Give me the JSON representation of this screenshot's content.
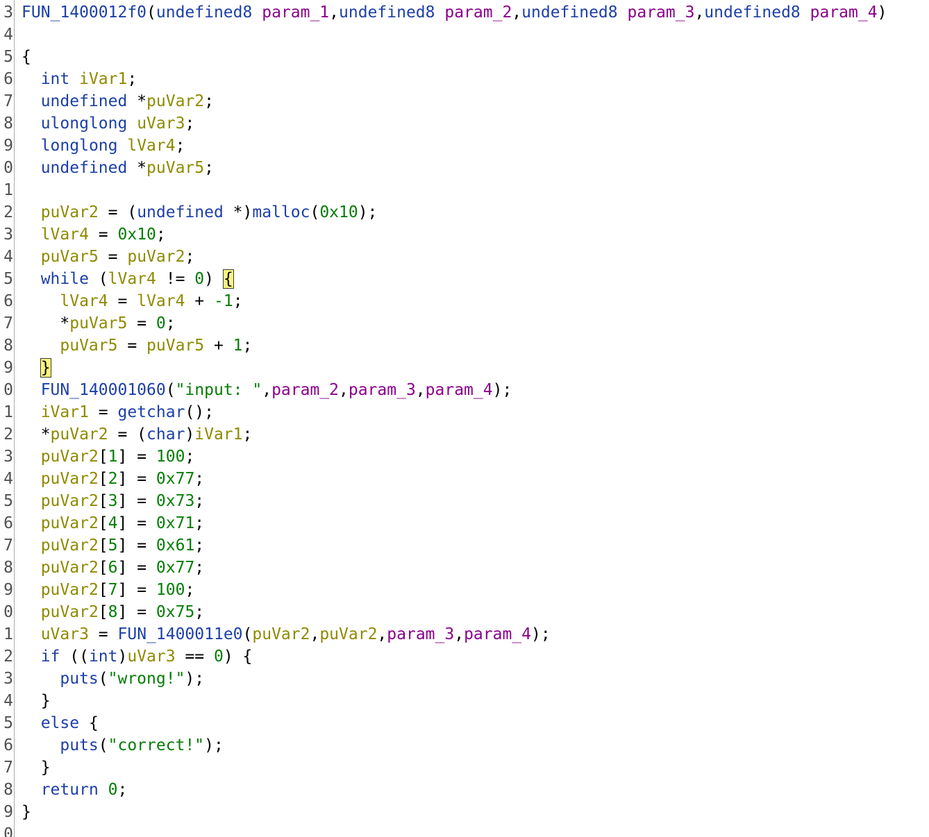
{
  "decompiler": {
    "colors": {
      "type": "#1d3fa8",
      "param": "#8b008b",
      "variable": "#8e8a00",
      "number": "#047d04",
      "string": "#047d04",
      "highlight": "#fbf77d"
    },
    "lines": [
      {
        "n": "3",
        "tokens": [
          {
            "t": "FUN_1400012f0",
            "c": "fn"
          },
          {
            "t": "(",
            "c": "punc"
          },
          {
            "t": "undefined8",
            "c": "type"
          },
          {
            "t": " ",
            "c": "punc"
          },
          {
            "t": "param_1",
            "c": "param"
          },
          {
            "t": ",",
            "c": "punc"
          },
          {
            "t": "undefined8",
            "c": "type"
          },
          {
            "t": " ",
            "c": "punc"
          },
          {
            "t": "param_2",
            "c": "param"
          },
          {
            "t": ",",
            "c": "punc"
          },
          {
            "t": "undefined8",
            "c": "type"
          },
          {
            "t": " ",
            "c": "punc"
          },
          {
            "t": "param_3",
            "c": "param"
          },
          {
            "t": ",",
            "c": "punc"
          },
          {
            "t": "undefined8",
            "c": "type"
          },
          {
            "t": " ",
            "c": "punc"
          },
          {
            "t": "param_4",
            "c": "param"
          },
          {
            "t": ")",
            "c": "punc"
          }
        ]
      },
      {
        "n": "4",
        "tokens": []
      },
      {
        "n": "5",
        "tokens": [
          {
            "t": "{",
            "c": "punc"
          }
        ]
      },
      {
        "n": "6",
        "tokens": [
          {
            "t": "  ",
            "c": "punc"
          },
          {
            "t": "int",
            "c": "type"
          },
          {
            "t": " ",
            "c": "punc"
          },
          {
            "t": "iVar1",
            "c": "var"
          },
          {
            "t": ";",
            "c": "punc"
          }
        ]
      },
      {
        "n": "7",
        "tokens": [
          {
            "t": "  ",
            "c": "punc"
          },
          {
            "t": "undefined",
            "c": "type"
          },
          {
            "t": " *",
            "c": "punc"
          },
          {
            "t": "puVar2",
            "c": "var"
          },
          {
            "t": ";",
            "c": "punc"
          }
        ]
      },
      {
        "n": "8",
        "tokens": [
          {
            "t": "  ",
            "c": "punc"
          },
          {
            "t": "ulonglong",
            "c": "type"
          },
          {
            "t": " ",
            "c": "punc"
          },
          {
            "t": "uVar3",
            "c": "var"
          },
          {
            "t": ";",
            "c": "punc"
          }
        ]
      },
      {
        "n": "9",
        "tokens": [
          {
            "t": "  ",
            "c": "punc"
          },
          {
            "t": "longlong",
            "c": "type"
          },
          {
            "t": " ",
            "c": "punc"
          },
          {
            "t": "lVar4",
            "c": "var"
          },
          {
            "t": ";",
            "c": "punc"
          }
        ]
      },
      {
        "n": "0",
        "tokens": [
          {
            "t": "  ",
            "c": "punc"
          },
          {
            "t": "undefined",
            "c": "type"
          },
          {
            "t": " *",
            "c": "punc"
          },
          {
            "t": "puVar5",
            "c": "var"
          },
          {
            "t": ";",
            "c": "punc"
          }
        ]
      },
      {
        "n": "1",
        "tokens": []
      },
      {
        "n": "2",
        "tokens": [
          {
            "t": "  ",
            "c": "punc"
          },
          {
            "t": "puVar2",
            "c": "var"
          },
          {
            "t": " = (",
            "c": "punc"
          },
          {
            "t": "undefined",
            "c": "type"
          },
          {
            "t": " *)",
            "c": "punc"
          },
          {
            "t": "malloc",
            "c": "fn"
          },
          {
            "t": "(",
            "c": "punc"
          },
          {
            "t": "0x10",
            "c": "num"
          },
          {
            "t": ");",
            "c": "punc"
          }
        ]
      },
      {
        "n": "3",
        "tokens": [
          {
            "t": "  ",
            "c": "punc"
          },
          {
            "t": "lVar4",
            "c": "var"
          },
          {
            "t": " = ",
            "c": "punc"
          },
          {
            "t": "0x10",
            "c": "num"
          },
          {
            "t": ";",
            "c": "punc"
          }
        ]
      },
      {
        "n": "4",
        "tokens": [
          {
            "t": "  ",
            "c": "punc"
          },
          {
            "t": "puVar5",
            "c": "var"
          },
          {
            "t": " = ",
            "c": "punc"
          },
          {
            "t": "puVar2",
            "c": "var"
          },
          {
            "t": ";",
            "c": "punc"
          }
        ]
      },
      {
        "n": "5",
        "tokens": [
          {
            "t": "  ",
            "c": "punc"
          },
          {
            "t": "while",
            "c": "kw"
          },
          {
            "t": " (",
            "c": "punc"
          },
          {
            "t": "lVar4",
            "c": "var"
          },
          {
            "t": " != ",
            "c": "punc"
          },
          {
            "t": "0",
            "c": "num"
          },
          {
            "t": ") ",
            "c": "punc"
          },
          {
            "t": "{",
            "c": "hl"
          }
        ]
      },
      {
        "n": "6",
        "tokens": [
          {
            "t": "    ",
            "c": "punc"
          },
          {
            "t": "lVar4",
            "c": "var"
          },
          {
            "t": " = ",
            "c": "punc"
          },
          {
            "t": "lVar4",
            "c": "var"
          },
          {
            "t": " + ",
            "c": "punc"
          },
          {
            "t": "-1",
            "c": "num"
          },
          {
            "t": ";",
            "c": "punc"
          }
        ]
      },
      {
        "n": "7",
        "tokens": [
          {
            "t": "    *",
            "c": "punc"
          },
          {
            "t": "puVar5",
            "c": "var"
          },
          {
            "t": " = ",
            "c": "punc"
          },
          {
            "t": "0",
            "c": "num"
          },
          {
            "t": ";",
            "c": "punc"
          }
        ]
      },
      {
        "n": "8",
        "tokens": [
          {
            "t": "    ",
            "c": "punc"
          },
          {
            "t": "puVar5",
            "c": "var"
          },
          {
            "t": " = ",
            "c": "punc"
          },
          {
            "t": "puVar5",
            "c": "var"
          },
          {
            "t": " + ",
            "c": "punc"
          },
          {
            "t": "1",
            "c": "num"
          },
          {
            "t": ";",
            "c": "punc"
          }
        ]
      },
      {
        "n": "9",
        "tokens": [
          {
            "t": "  ",
            "c": "punc"
          },
          {
            "t": "}",
            "c": "hl"
          }
        ]
      },
      {
        "n": "0",
        "tokens": [
          {
            "t": "  ",
            "c": "punc"
          },
          {
            "t": "FUN_140001060",
            "c": "fn"
          },
          {
            "t": "(",
            "c": "punc"
          },
          {
            "t": "\"input: \"",
            "c": "str"
          },
          {
            "t": ",",
            "c": "punc"
          },
          {
            "t": "param_2",
            "c": "param"
          },
          {
            "t": ",",
            "c": "punc"
          },
          {
            "t": "param_3",
            "c": "param"
          },
          {
            "t": ",",
            "c": "punc"
          },
          {
            "t": "param_4",
            "c": "param"
          },
          {
            "t": ");",
            "c": "punc"
          }
        ]
      },
      {
        "n": "1",
        "tokens": [
          {
            "t": "  ",
            "c": "punc"
          },
          {
            "t": "iVar1",
            "c": "var"
          },
          {
            "t": " = ",
            "c": "punc"
          },
          {
            "t": "getchar",
            "c": "fn"
          },
          {
            "t": "();",
            "c": "punc"
          }
        ]
      },
      {
        "n": "2",
        "tokens": [
          {
            "t": "  *",
            "c": "punc"
          },
          {
            "t": "puVar2",
            "c": "var"
          },
          {
            "t": " = (",
            "c": "punc"
          },
          {
            "t": "char",
            "c": "type"
          },
          {
            "t": ")",
            "c": "punc"
          },
          {
            "t": "iVar1",
            "c": "var"
          },
          {
            "t": ";",
            "c": "punc"
          }
        ]
      },
      {
        "n": "3",
        "tokens": [
          {
            "t": "  ",
            "c": "punc"
          },
          {
            "t": "puVar2",
            "c": "var"
          },
          {
            "t": "[",
            "c": "punc"
          },
          {
            "t": "1",
            "c": "num"
          },
          {
            "t": "] = ",
            "c": "punc"
          },
          {
            "t": "100",
            "c": "num"
          },
          {
            "t": ";",
            "c": "punc"
          }
        ]
      },
      {
        "n": "4",
        "tokens": [
          {
            "t": "  ",
            "c": "punc"
          },
          {
            "t": "puVar2",
            "c": "var"
          },
          {
            "t": "[",
            "c": "punc"
          },
          {
            "t": "2",
            "c": "num"
          },
          {
            "t": "] = ",
            "c": "punc"
          },
          {
            "t": "0x77",
            "c": "num"
          },
          {
            "t": ";",
            "c": "punc"
          }
        ]
      },
      {
        "n": "5",
        "tokens": [
          {
            "t": "  ",
            "c": "punc"
          },
          {
            "t": "puVar2",
            "c": "var"
          },
          {
            "t": "[",
            "c": "punc"
          },
          {
            "t": "3",
            "c": "num"
          },
          {
            "t": "] = ",
            "c": "punc"
          },
          {
            "t": "0x73",
            "c": "num"
          },
          {
            "t": ";",
            "c": "punc"
          }
        ]
      },
      {
        "n": "6",
        "tokens": [
          {
            "t": "  ",
            "c": "punc"
          },
          {
            "t": "puVar2",
            "c": "var"
          },
          {
            "t": "[",
            "c": "punc"
          },
          {
            "t": "4",
            "c": "num"
          },
          {
            "t": "] = ",
            "c": "punc"
          },
          {
            "t": "0x71",
            "c": "num"
          },
          {
            "t": ";",
            "c": "punc"
          }
        ]
      },
      {
        "n": "7",
        "tokens": [
          {
            "t": "  ",
            "c": "punc"
          },
          {
            "t": "puVar2",
            "c": "var"
          },
          {
            "t": "[",
            "c": "punc"
          },
          {
            "t": "5",
            "c": "num"
          },
          {
            "t": "] = ",
            "c": "punc"
          },
          {
            "t": "0x61",
            "c": "num"
          },
          {
            "t": ";",
            "c": "punc"
          }
        ]
      },
      {
        "n": "8",
        "tokens": [
          {
            "t": "  ",
            "c": "punc"
          },
          {
            "t": "puVar2",
            "c": "var"
          },
          {
            "t": "[",
            "c": "punc"
          },
          {
            "t": "6",
            "c": "num"
          },
          {
            "t": "] = ",
            "c": "punc"
          },
          {
            "t": "0x77",
            "c": "num"
          },
          {
            "t": ";",
            "c": "punc"
          }
        ]
      },
      {
        "n": "9",
        "tokens": [
          {
            "t": "  ",
            "c": "punc"
          },
          {
            "t": "puVar2",
            "c": "var"
          },
          {
            "t": "[",
            "c": "punc"
          },
          {
            "t": "7",
            "c": "num"
          },
          {
            "t": "] = ",
            "c": "punc"
          },
          {
            "t": "100",
            "c": "num"
          },
          {
            "t": ";",
            "c": "punc"
          }
        ]
      },
      {
        "n": "0",
        "tokens": [
          {
            "t": "  ",
            "c": "punc"
          },
          {
            "t": "puVar2",
            "c": "var"
          },
          {
            "t": "[",
            "c": "punc"
          },
          {
            "t": "8",
            "c": "num"
          },
          {
            "t": "] = ",
            "c": "punc"
          },
          {
            "t": "0x75",
            "c": "num"
          },
          {
            "t": ";",
            "c": "punc"
          }
        ]
      },
      {
        "n": "1",
        "tokens": [
          {
            "t": "  ",
            "c": "punc"
          },
          {
            "t": "uVar3",
            "c": "var"
          },
          {
            "t": " = ",
            "c": "punc"
          },
          {
            "t": "FUN_1400011e0",
            "c": "fn"
          },
          {
            "t": "(",
            "c": "punc"
          },
          {
            "t": "puVar2",
            "c": "var"
          },
          {
            "t": ",",
            "c": "punc"
          },
          {
            "t": "puVar2",
            "c": "var"
          },
          {
            "t": ",",
            "c": "punc"
          },
          {
            "t": "param_3",
            "c": "param"
          },
          {
            "t": ",",
            "c": "punc"
          },
          {
            "t": "param_4",
            "c": "param"
          },
          {
            "t": ");",
            "c": "punc"
          }
        ]
      },
      {
        "n": "2",
        "tokens": [
          {
            "t": "  ",
            "c": "punc"
          },
          {
            "t": "if",
            "c": "kw"
          },
          {
            "t": " ((",
            "c": "punc"
          },
          {
            "t": "int",
            "c": "type"
          },
          {
            "t": ")",
            "c": "punc"
          },
          {
            "t": "uVar3",
            "c": "var"
          },
          {
            "t": " == ",
            "c": "punc"
          },
          {
            "t": "0",
            "c": "num"
          },
          {
            "t": ") {",
            "c": "punc"
          }
        ]
      },
      {
        "n": "3",
        "tokens": [
          {
            "t": "    ",
            "c": "punc"
          },
          {
            "t": "puts",
            "c": "fn"
          },
          {
            "t": "(",
            "c": "punc"
          },
          {
            "t": "\"wrong!\"",
            "c": "str"
          },
          {
            "t": ");",
            "c": "punc"
          }
        ]
      },
      {
        "n": "4",
        "tokens": [
          {
            "t": "  }",
            "c": "punc"
          }
        ]
      },
      {
        "n": "5",
        "tokens": [
          {
            "t": "  ",
            "c": "punc"
          },
          {
            "t": "else",
            "c": "kw"
          },
          {
            "t": " {",
            "c": "punc"
          }
        ]
      },
      {
        "n": "6",
        "tokens": [
          {
            "t": "    ",
            "c": "punc"
          },
          {
            "t": "puts",
            "c": "fn"
          },
          {
            "t": "(",
            "c": "punc"
          },
          {
            "t": "\"correct!\"",
            "c": "str"
          },
          {
            "t": ");",
            "c": "punc"
          }
        ]
      },
      {
        "n": "7",
        "tokens": [
          {
            "t": "  }",
            "c": "punc"
          }
        ]
      },
      {
        "n": "8",
        "tokens": [
          {
            "t": "  ",
            "c": "punc"
          },
          {
            "t": "return",
            "c": "kw"
          },
          {
            "t": " ",
            "c": "punc"
          },
          {
            "t": "0",
            "c": "num"
          },
          {
            "t": ";",
            "c": "punc"
          }
        ]
      },
      {
        "n": "9",
        "tokens": [
          {
            "t": "}",
            "c": "punc"
          }
        ]
      },
      {
        "n": "0",
        "tokens": []
      }
    ]
  }
}
